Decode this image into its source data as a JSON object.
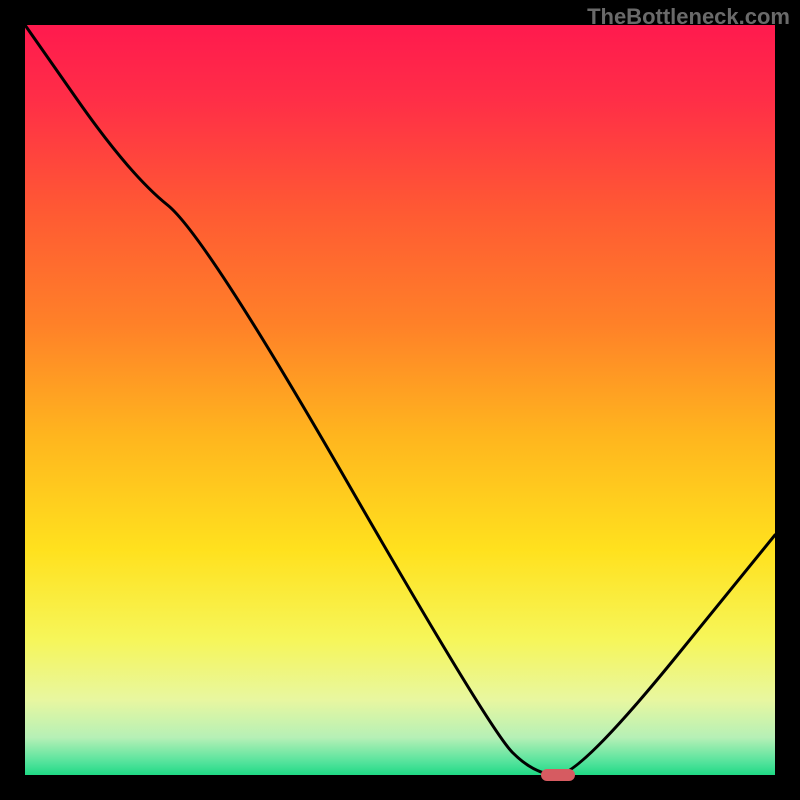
{
  "watermark": "TheBottleneck.com",
  "chart_data": {
    "type": "line",
    "title": "",
    "xlabel": "",
    "ylabel": "",
    "xlim": [
      0,
      100
    ],
    "ylim": [
      0,
      100
    ],
    "grid": false,
    "legend": false,
    "series": [
      {
        "name": "curve",
        "x": [
          0,
          14,
          24,
          62,
          68,
          74,
          100
        ],
        "y": [
          100,
          80,
          72,
          6,
          0,
          0,
          32
        ]
      }
    ],
    "marker": {
      "x": 71,
      "y": 0,
      "color": "#d65b61"
    },
    "gradient_stops": [
      {
        "pct": 0.0,
        "color": "#ff1a4e"
      },
      {
        "pct": 0.1,
        "color": "#ff2e47"
      },
      {
        "pct": 0.25,
        "color": "#ff5a33"
      },
      {
        "pct": 0.4,
        "color": "#ff8128"
      },
      {
        "pct": 0.55,
        "color": "#ffb61e"
      },
      {
        "pct": 0.7,
        "color": "#ffe11e"
      },
      {
        "pct": 0.82,
        "color": "#f6f65a"
      },
      {
        "pct": 0.9,
        "color": "#e8f7a0"
      },
      {
        "pct": 0.95,
        "color": "#b6f0b6"
      },
      {
        "pct": 0.985,
        "color": "#4de29a"
      },
      {
        "pct": 1.0,
        "color": "#1fd984"
      }
    ]
  }
}
